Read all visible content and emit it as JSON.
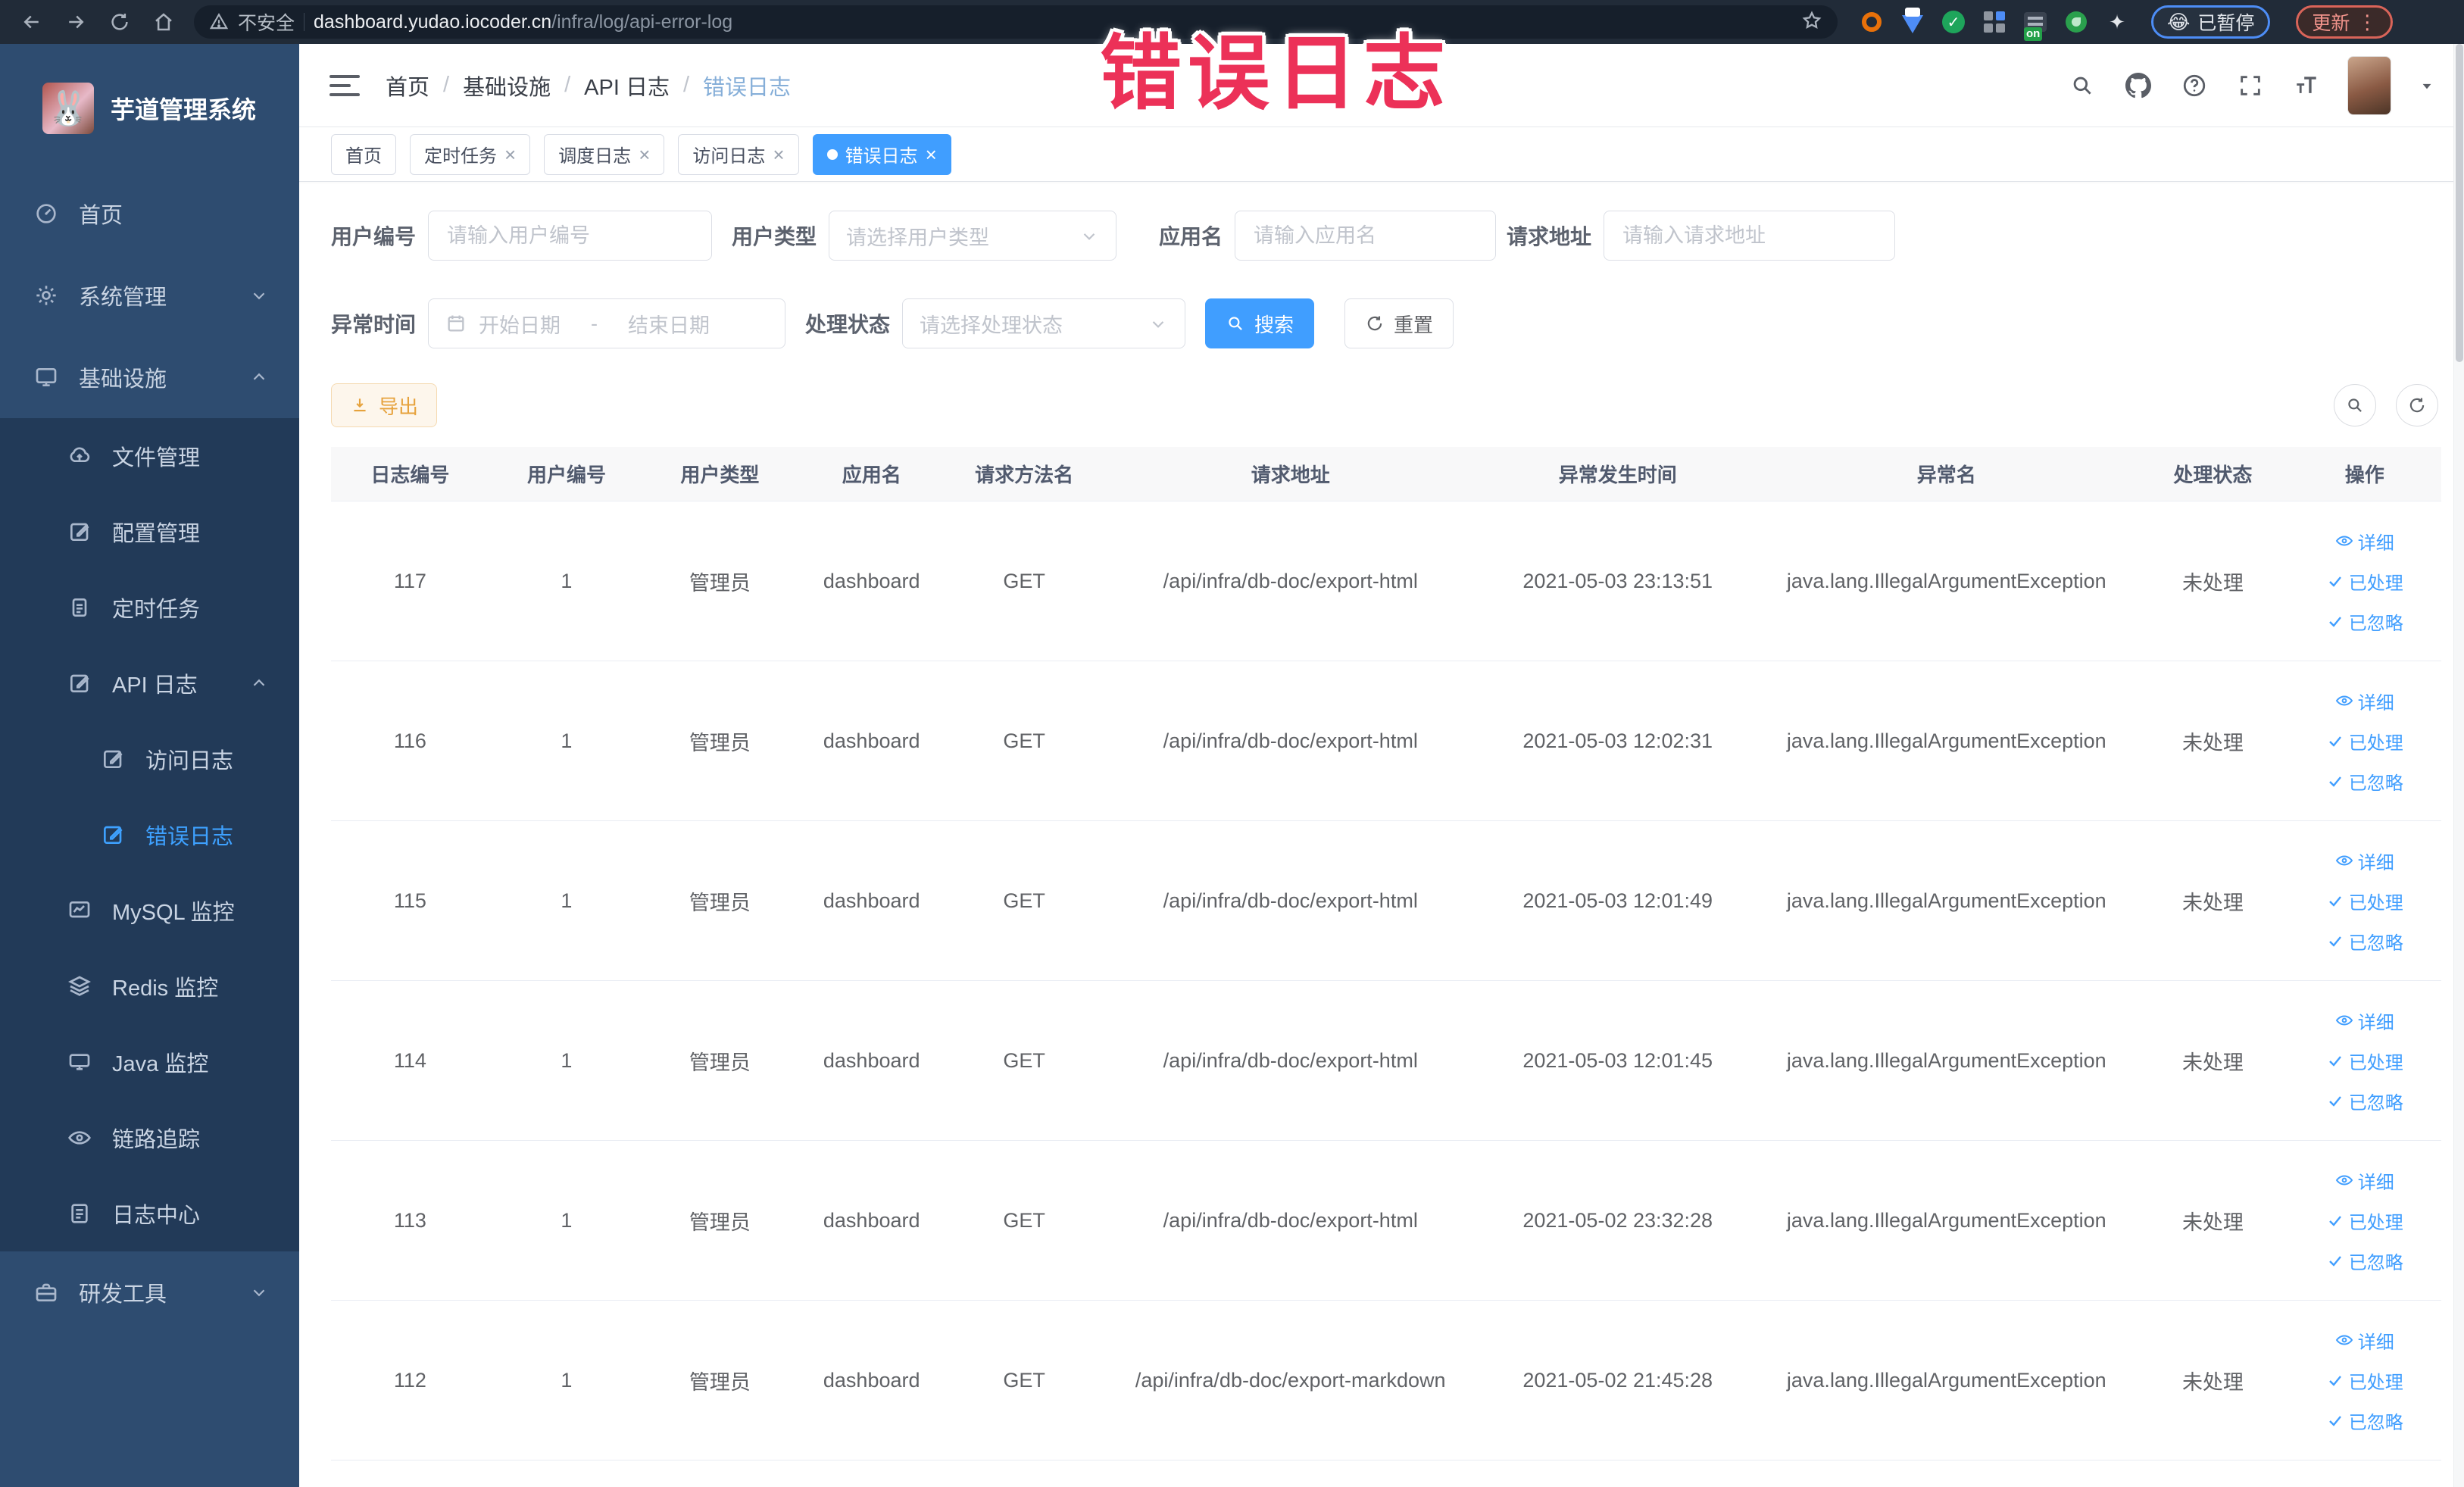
{
  "annotation": {
    "text": "错误日志"
  },
  "browser": {
    "security": "不安全",
    "host": "dashboard.yudao.iocoder.cn",
    "path": "/infra/log/api-error-log",
    "paused_label": "已暂停",
    "paused_emoji": "😂",
    "update_label": "更新",
    "ext_on": "on"
  },
  "sidebar": {
    "logo_title": "芋道管理系统",
    "logo_emoji": "🐰",
    "menu": [
      {
        "name": "home",
        "label": "首页",
        "icon": "gauge",
        "level": 0
      },
      {
        "name": "system-management",
        "label": "系统管理",
        "icon": "gear",
        "level": 0,
        "chevron": "down"
      },
      {
        "name": "infrastructure",
        "label": "基础设施",
        "icon": "monitor",
        "level": 0,
        "chevron": "up"
      },
      {
        "name": "file-management",
        "label": "文件管理",
        "icon": "cloud",
        "level": 1,
        "group": true
      },
      {
        "name": "config-management",
        "label": "配置管理",
        "icon": "edit",
        "level": 1,
        "group": true
      },
      {
        "name": "scheduled-tasks",
        "label": "定时任务",
        "icon": "clipboard",
        "level": 1,
        "group": true
      },
      {
        "name": "api-log",
        "label": "API 日志",
        "icon": "edit",
        "level": 1,
        "group": true,
        "chevron": "up"
      },
      {
        "name": "access-log",
        "label": "访问日志",
        "icon": "edit",
        "level": 2,
        "group": true
      },
      {
        "name": "error-log",
        "label": "错误日志",
        "icon": "edit",
        "level": 2,
        "group": true,
        "active": true
      },
      {
        "name": "mysql-monitor",
        "label": "MySQL 监控",
        "icon": "chart",
        "level": 1,
        "group": true
      },
      {
        "name": "redis-monitor",
        "label": "Redis 监控",
        "icon": "layers",
        "level": 1,
        "group": true
      },
      {
        "name": "java-monitor",
        "label": "Java 监控",
        "icon": "screen",
        "level": 1,
        "group": true
      },
      {
        "name": "trace",
        "label": "链路追踪",
        "icon": "eye",
        "level": 1,
        "group": true
      },
      {
        "name": "log-center",
        "label": "日志中心",
        "icon": "doc",
        "level": 1,
        "group": true
      },
      {
        "name": "dev-tools",
        "label": "研发工具",
        "icon": "briefcase",
        "level": 0,
        "chevron": "down"
      }
    ]
  },
  "header": {
    "breadcrumb": [
      "首页",
      "基础设施",
      "API 日志",
      "错误日志"
    ]
  },
  "tabs": [
    {
      "name": "home",
      "label": "首页",
      "closable": false,
      "active": false
    },
    {
      "name": "scheduled-tasks",
      "label": "定时任务",
      "closable": true,
      "active": false
    },
    {
      "name": "schedule-log",
      "label": "调度日志",
      "closable": true,
      "active": false
    },
    {
      "name": "access-log",
      "label": "访问日志",
      "closable": true,
      "active": false
    },
    {
      "name": "error-log",
      "label": "错误日志",
      "closable": true,
      "active": true
    }
  ],
  "filters": {
    "user_id": {
      "label": "用户编号",
      "placeholder": "请输入用户编号"
    },
    "user_type": {
      "label": "用户类型",
      "placeholder": "请选择用户类型"
    },
    "app_name": {
      "label": "应用名",
      "placeholder": "请输入应用名"
    },
    "request_url": {
      "label": "请求地址",
      "placeholder": "请输入请求地址"
    },
    "exception_time": {
      "label": "异常时间",
      "start_placeholder": "开始日期",
      "separator": "-",
      "end_placeholder": "结束日期"
    },
    "process_status": {
      "label": "处理状态",
      "placeholder": "请选择处理状态"
    },
    "search_label": "搜索",
    "reset_label": "重置"
  },
  "toolbar": {
    "export_label": "导出"
  },
  "table": {
    "columns": [
      "日志编号",
      "用户编号",
      "用户类型",
      "应用名",
      "请求方法名",
      "请求地址",
      "异常发生时间",
      "异常名",
      "处理状态",
      "操作"
    ],
    "row_actions": [
      {
        "name": "detail",
        "label": "详细",
        "icon": "eye-sm"
      },
      {
        "name": "done",
        "label": "已处理",
        "icon": "check"
      },
      {
        "name": "ignored",
        "label": "已忽略",
        "icon": "check"
      }
    ],
    "rows": [
      {
        "id": "117",
        "user_id": "1",
        "user_type": "管理员",
        "app": "dashboard",
        "method": "GET",
        "url": "/api/infra/db-doc/export-html",
        "time": "2021-05-03 23:13:51",
        "exception": "java.lang.IllegalArgumentException",
        "status": "未处理"
      },
      {
        "id": "116",
        "user_id": "1",
        "user_type": "管理员",
        "app": "dashboard",
        "method": "GET",
        "url": "/api/infra/db-doc/export-html",
        "time": "2021-05-03 12:02:31",
        "exception": "java.lang.IllegalArgumentException",
        "status": "未处理"
      },
      {
        "id": "115",
        "user_id": "1",
        "user_type": "管理员",
        "app": "dashboard",
        "method": "GET",
        "url": "/api/infra/db-doc/export-html",
        "time": "2021-05-03 12:01:49",
        "exception": "java.lang.IllegalArgumentException",
        "status": "未处理"
      },
      {
        "id": "114",
        "user_id": "1",
        "user_type": "管理员",
        "app": "dashboard",
        "method": "GET",
        "url": "/api/infra/db-doc/export-html",
        "time": "2021-05-03 12:01:45",
        "exception": "java.lang.IllegalArgumentException",
        "status": "未处理"
      },
      {
        "id": "113",
        "user_id": "1",
        "user_type": "管理员",
        "app": "dashboard",
        "method": "GET",
        "url": "/api/infra/db-doc/export-html",
        "time": "2021-05-02 23:32:28",
        "exception": "java.lang.IllegalArgumentException",
        "status": "未处理"
      },
      {
        "id": "112",
        "user_id": "1",
        "user_type": "管理员",
        "app": "dashboard",
        "method": "GET",
        "url": "/api/infra/db-doc/export-markdown",
        "time": "2021-05-02 21:45:28",
        "exception": "java.lang.IllegalArgumentException",
        "status": "未处理"
      }
    ]
  },
  "colors": {
    "accent": "#409eff",
    "warning": "#e6a23c",
    "annotation": "#ec3158",
    "sidebar": "#2e4c70",
    "sidebar_sub": "#223a58"
  }
}
